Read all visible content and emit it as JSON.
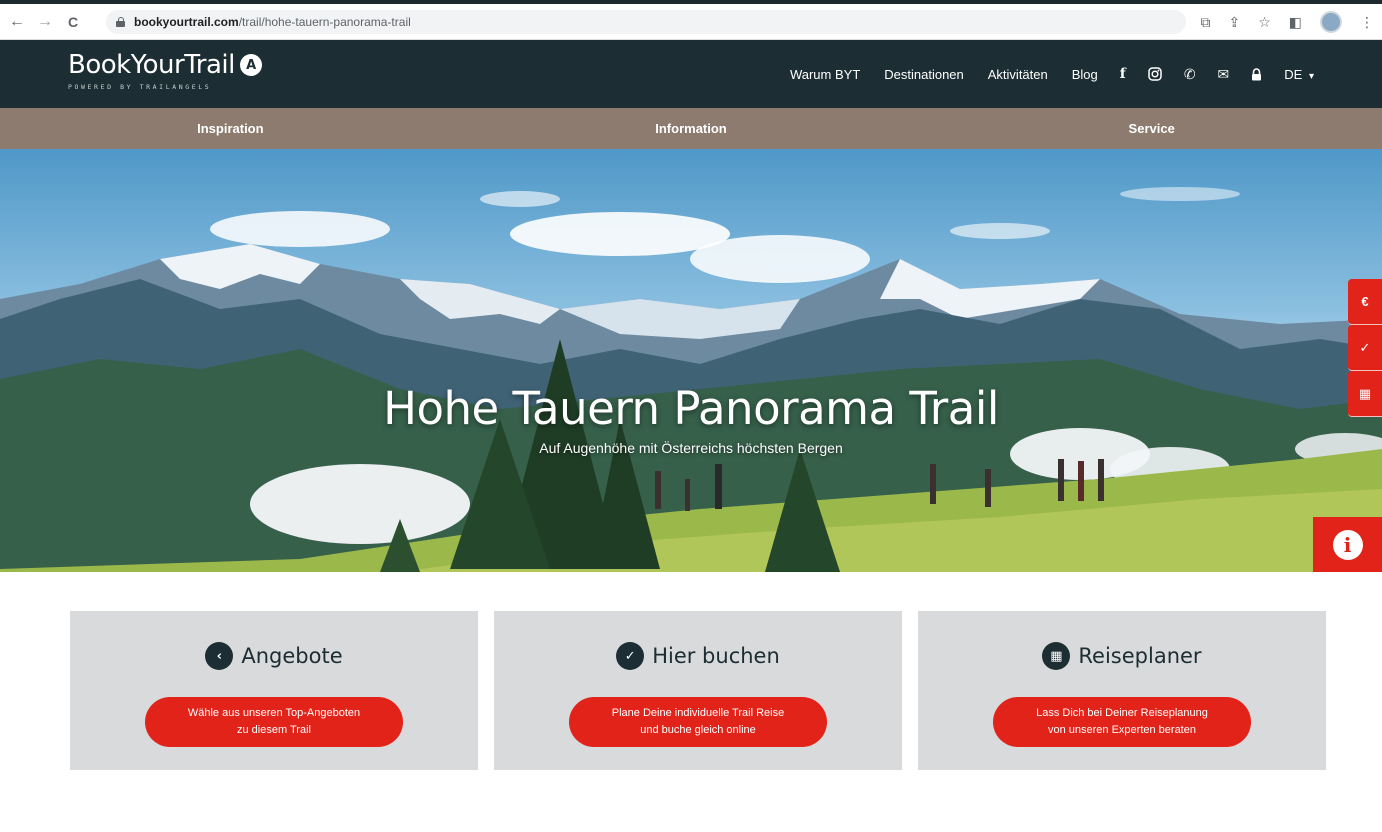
{
  "browser": {
    "back_glyph": "←",
    "forward_glyph": "→",
    "reload_glyph": "C",
    "url_host": "bookyourtrail.com",
    "url_path": "/trail/hohe-tauern-panorama-trail",
    "toolbar_icons": [
      "install-icon",
      "share-icon",
      "star-icon",
      "sidepanel-icon",
      "profile-avatar",
      "menu-icon"
    ]
  },
  "header": {
    "logo_text": "BookYourTrail",
    "logo_badge": "A",
    "logo_tagline": "POWERED BY TRAILANGELS",
    "nav": [
      "Warum BYT",
      "Destinationen",
      "Aktivitäten",
      "Blog"
    ],
    "icons": [
      "facebook-icon",
      "instagram-icon",
      "phone-icon",
      "mail-icon",
      "lock-icon"
    ],
    "language": "DE"
  },
  "subnav": [
    "Inspiration",
    "Information",
    "Service"
  ],
  "hero": {
    "title": "Hohe Tauern Panorama Trail",
    "subtitle": "Auf Augenhöhe mit Österreichs höchsten Bergen"
  },
  "side_tabs": [
    "€",
    "✓",
    "▦"
  ],
  "info_button": "i",
  "cards": [
    {
      "icon": "‹",
      "title": "Angebote",
      "button_line1": "Wähle aus unseren Top-Angeboten",
      "button_line2": "zu diesem Trail"
    },
    {
      "icon": "✓",
      "title": "Hier buchen",
      "button_line1": "Plane Deine individuelle Trail Reise",
      "button_line2": "und buche gleich online"
    },
    {
      "icon": "▦",
      "title": "Reiseplaner",
      "button_line1": "Lass Dich bei Deiner Reiseplanung",
      "button_line2": "von unseren Experten beraten"
    }
  ],
  "colors": {
    "header_bg": "#1c2d33",
    "subnav_bg": "#8c7b6e",
    "accent_red": "#e2231a",
    "card_bg": "#d9dadb"
  }
}
